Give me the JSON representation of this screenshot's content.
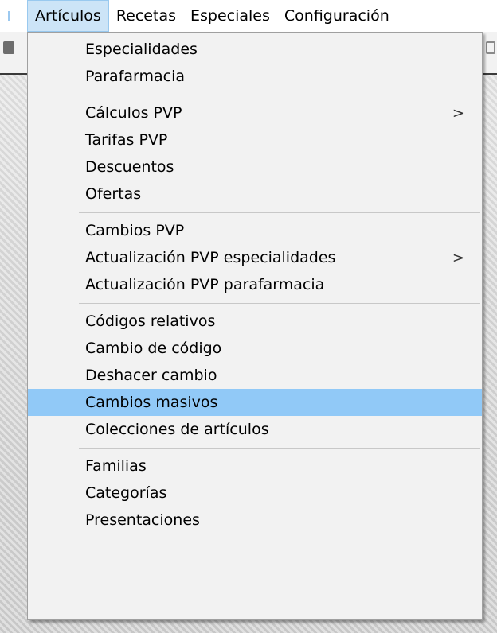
{
  "menubar": {
    "items": [
      {
        "label": "Artículos",
        "active": true
      },
      {
        "label": "Recetas",
        "active": false
      },
      {
        "label": "Especiales",
        "active": false
      },
      {
        "label": "Configuración",
        "active": false
      }
    ]
  },
  "dropdown": {
    "groups": [
      [
        {
          "label": "Especialidades"
        },
        {
          "label": "Parafarmacia"
        }
      ],
      [
        {
          "label": "Cálculos PVP",
          "submenu_arrow": ">"
        },
        {
          "label": "Tarifas PVP"
        },
        {
          "label": "Descuentos"
        },
        {
          "label": "Ofertas"
        }
      ],
      [
        {
          "label": "Cambios PVP"
        },
        {
          "label": "Actualización PVP especialidades",
          "submenu_arrow": ">"
        },
        {
          "label": "Actualización PVP parafarmacia"
        }
      ],
      [
        {
          "label": "Códigos relativos"
        },
        {
          "label": "Cambio de código"
        },
        {
          "label": "Deshacer cambio"
        },
        {
          "label": "Cambios masivos",
          "highlighted": true
        },
        {
          "label": "Colecciones de artículos"
        }
      ],
      [
        {
          "label": "Familias"
        },
        {
          "label": "Categorías"
        },
        {
          "label": "Presentaciones"
        }
      ]
    ]
  },
  "colors": {
    "highlight": "#91c9f7",
    "menubar_active": "#cce4f7",
    "menu_background": "#f2f2f2"
  }
}
